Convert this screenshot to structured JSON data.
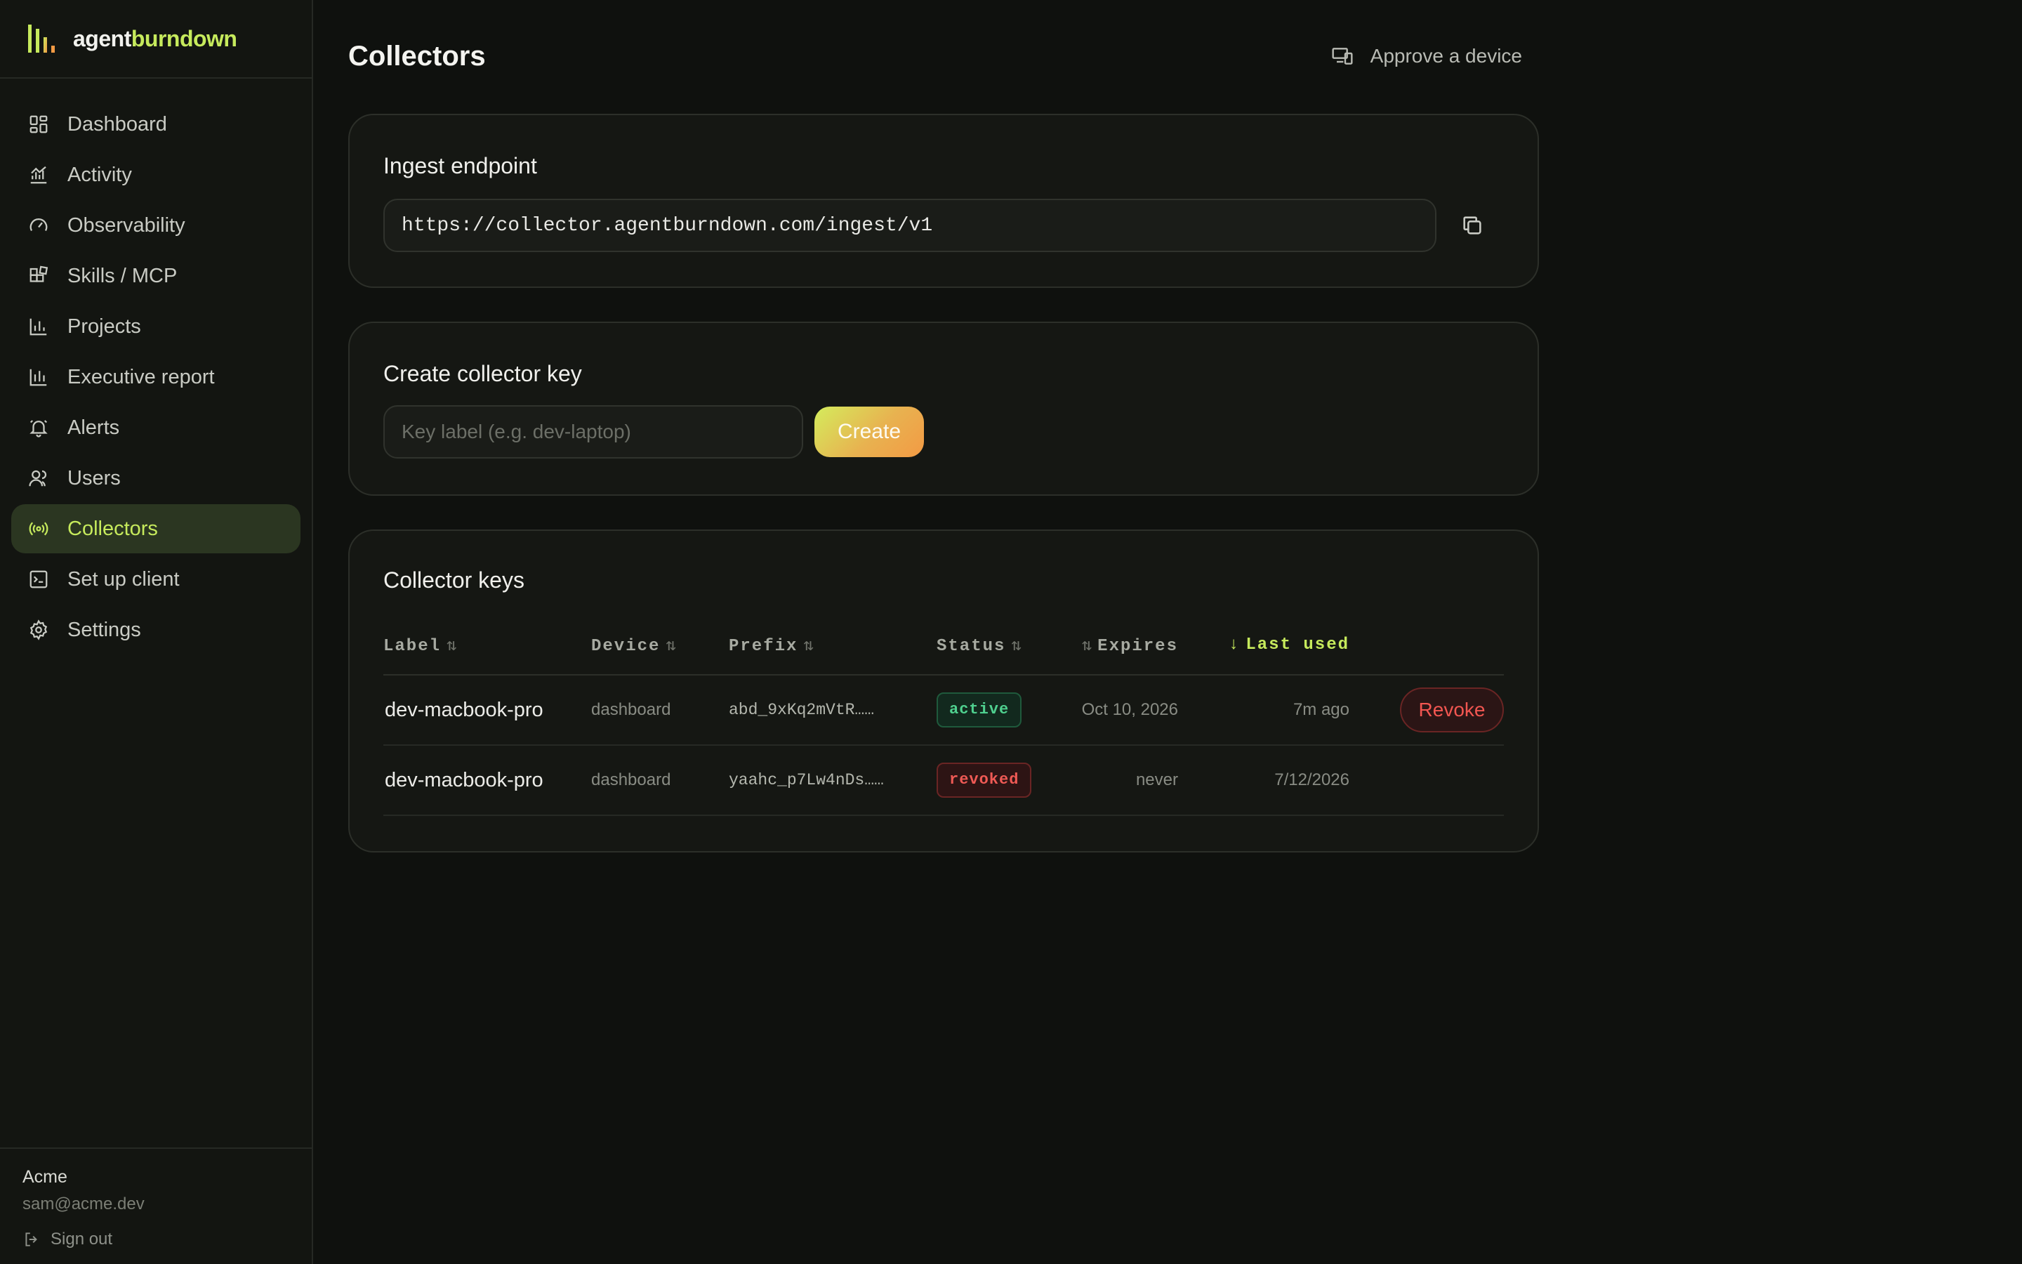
{
  "brand": {
    "name_part1": "agent",
    "name_part2": "burndown",
    "logo_icon": "bars-logo-icon",
    "accent_color": "#c6ea5c"
  },
  "sidebar": {
    "items": [
      {
        "label": "Dashboard",
        "icon": "dashboard-grid-icon",
        "active": false
      },
      {
        "label": "Activity",
        "icon": "activity-chart-icon",
        "active": false
      },
      {
        "label": "Observability",
        "icon": "gauge-icon",
        "active": false
      },
      {
        "label": "Skills / MCP",
        "icon": "blocks-icon",
        "active": false
      },
      {
        "label": "Projects",
        "icon": "bar-chart-icon",
        "active": false
      },
      {
        "label": "Executive report",
        "icon": "report-chart-icon",
        "active": false
      },
      {
        "label": "Alerts",
        "icon": "bell-icon",
        "active": false
      },
      {
        "label": "Users",
        "icon": "users-icon",
        "active": false
      },
      {
        "label": "Collectors",
        "icon": "radio-signal-icon",
        "active": true
      },
      {
        "label": "Set up client",
        "icon": "terminal-icon",
        "active": false
      },
      {
        "label": "Settings",
        "icon": "gear-icon",
        "active": false
      }
    ],
    "footer": {
      "org": "Acme",
      "email": "sam@acme.dev",
      "signout_label": "Sign out"
    }
  },
  "header": {
    "title": "Collectors",
    "approve_label": "Approve a device"
  },
  "ingest": {
    "title": "Ingest endpoint",
    "url": "https://collector.agentburndown.com/ingest/v1"
  },
  "create": {
    "title": "Create collector key",
    "placeholder": "Key label (e.g. dev-laptop)",
    "button_label": "Create"
  },
  "keys": {
    "title": "Collector keys",
    "columns": {
      "label": "Label",
      "device": "Device",
      "prefix": "Prefix",
      "status": "Status",
      "expires": "Expires",
      "last_used": "Last used"
    },
    "sort_glyph": "⇅",
    "sort_active_glyph": "↓",
    "rows": [
      {
        "label": "dev-macbook-pro",
        "device": "dashboard",
        "prefix": "abd_9xKq2mVtR……",
        "status": "active",
        "expires": "Oct 10, 2026",
        "last_used": "7m ago",
        "action": "Revoke"
      },
      {
        "label": "dev-macbook-pro",
        "device": "dashboard",
        "prefix": "yaahc_p7Lw4nDs……",
        "status": "revoked",
        "expires": "never",
        "last_used": "7/12/2026",
        "action": ""
      }
    ]
  },
  "colors": {
    "status_active": "#4fd08f",
    "status_revoked": "#ef5a55",
    "create_gradient_start": "#d4ec5c",
    "create_gradient_end": "#f39a44"
  }
}
